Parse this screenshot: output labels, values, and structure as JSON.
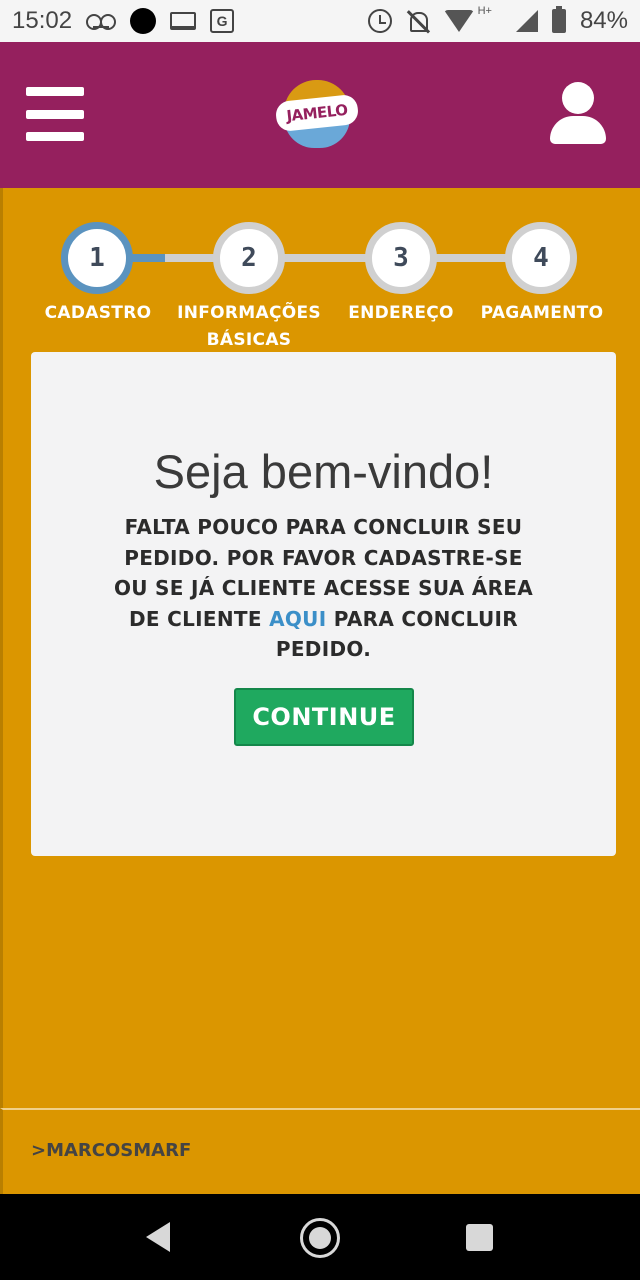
{
  "status_bar": {
    "time": "15:02",
    "battery": "84%",
    "network": "H+",
    "icons": [
      "voicemail-icon",
      "notification-dot-icon",
      "laptop-icon",
      "translate-icon",
      "alarm-icon",
      "bell-off-icon",
      "wifi-icon",
      "signal-icon",
      "battery-icon"
    ]
  },
  "header": {
    "logo_text": "JAMELO",
    "menu_icon": "hamburger-menu-icon",
    "user_icon": "user-icon",
    "background": "#95205e"
  },
  "steps": [
    {
      "number": "1",
      "label": "CADASTRO",
      "active": true
    },
    {
      "number": "2",
      "label": "INFORMAÇÕES\nBÁSICAS",
      "active": false
    },
    {
      "number": "3",
      "label": "ENDEREÇO",
      "active": false
    },
    {
      "number": "4",
      "label": "PAGAMENTO",
      "active": false
    }
  ],
  "card": {
    "title": "Seja bem-vindo!",
    "message_before": "FALTA POUCO PARA CONCLUIR SEU PEDIDO. POR FAVOR CADASTRE-SE OU SE JÁ CLIENTE ACESSE SUA ÁREA DE CLIENTE ",
    "message_link": "AQUI",
    "message_after": " PARA CONCLUIR PEDIDO.",
    "button_label": "CONTINUE"
  },
  "footer": {
    "credit": ">MARCOSMARF"
  },
  "colors": {
    "accent": "#db9600",
    "active_step": "#5b93bf",
    "button": "#1fa95f",
    "link": "#3b8fc8"
  }
}
